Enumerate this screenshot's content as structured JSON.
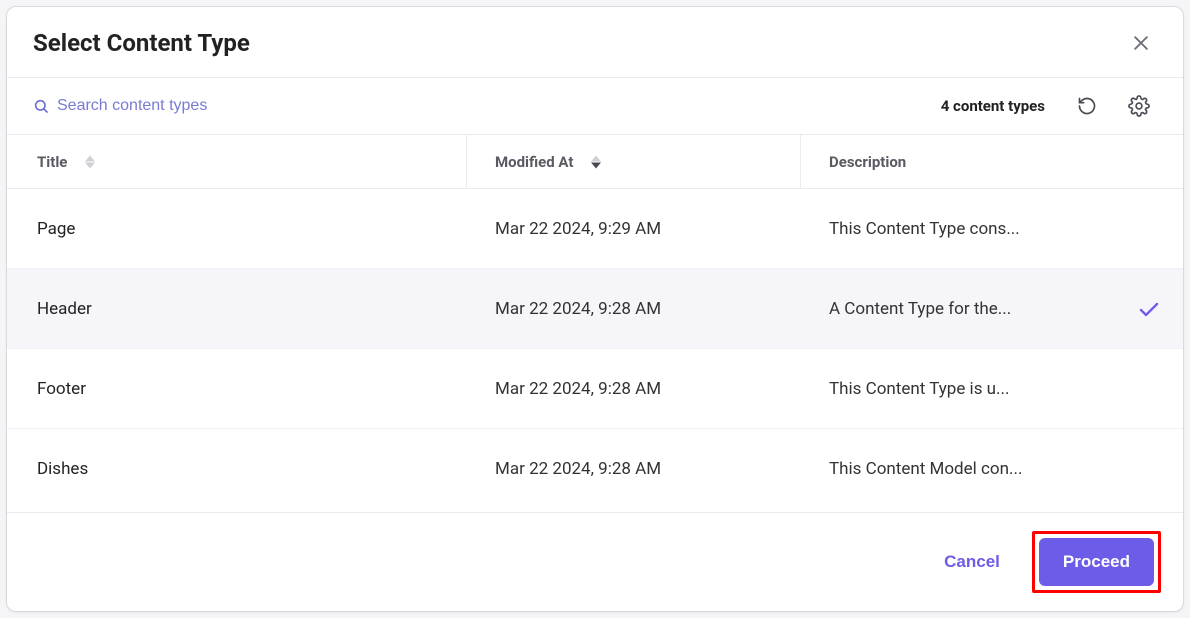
{
  "modal": {
    "title": "Select Content Type"
  },
  "search": {
    "placeholder": "Search content types"
  },
  "count_text": "4 content types",
  "columns": {
    "title": "Title",
    "modified": "Modified At",
    "description": "Description"
  },
  "rows": [
    {
      "title": "Page",
      "modified": "Mar 22 2024, 9:29 AM",
      "description": "This Content Type cons...",
      "selected": false
    },
    {
      "title": "Header",
      "modified": "Mar 22 2024, 9:28 AM",
      "description": "A Content Type for the...",
      "selected": true
    },
    {
      "title": "Footer",
      "modified": "Mar 22 2024, 9:28 AM",
      "description": "This Content Type is u...",
      "selected": false
    },
    {
      "title": "Dishes",
      "modified": "Mar 22 2024, 9:28 AM",
      "description": "This Content Model con...",
      "selected": false
    }
  ],
  "footer": {
    "cancel": "Cancel",
    "proceed": "Proceed"
  }
}
